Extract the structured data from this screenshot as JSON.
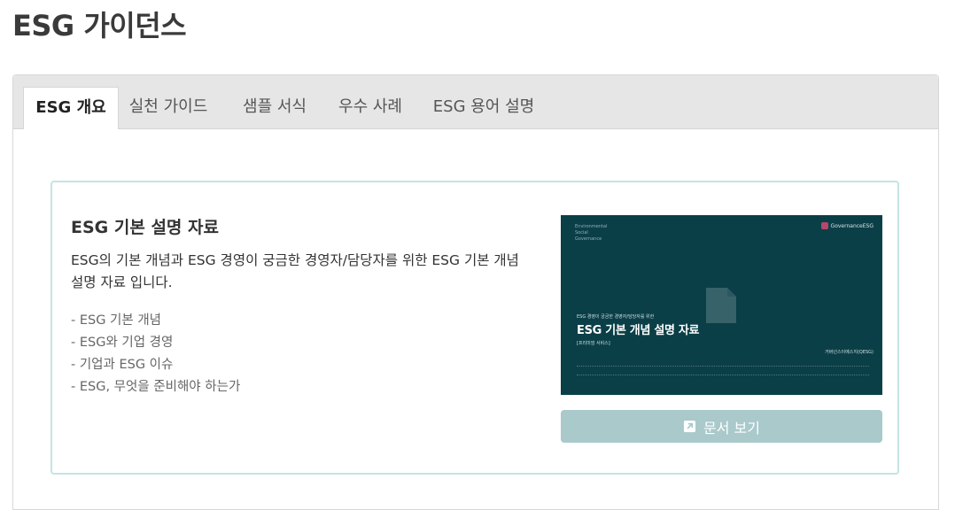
{
  "page": {
    "title": "ESG 가이던스"
  },
  "tabs": [
    {
      "label": "ESG 개요",
      "active": true
    },
    {
      "label": "실천 가이드",
      "active": false
    },
    {
      "label": "샘플 서식",
      "active": false
    },
    {
      "label": "우수 사례",
      "active": false
    },
    {
      "label": "ESG 용어 설명",
      "active": false
    }
  ],
  "card": {
    "title": "ESG 기본 설명 자료",
    "description": "ESG의 기본 개념과 ESG 경영이 궁금한 경영자/담당자를 위한 ESG 기본 개념 설명 자료 입니다.",
    "topics": [
      "- ESG 기본 개념",
      "- ESG와 기업 경영",
      "- 기업과 ESG 이슈",
      "- ESG, 무엇을 준비해야 하는가"
    ],
    "thumbnail": {
      "tagline": [
        "Environmental",
        "Social",
        "Governance"
      ],
      "brand": "GovernanceESG",
      "subtitle": "ESG 경영이 궁금한 경영자/담당자를 위한",
      "main_title": "ESG 기본 개념 설명 자료",
      "tag": "[프리미엄 서비스]",
      "org": "거버넌스이에스지(QESG)"
    },
    "button": {
      "label": "문서 보기",
      "icon": "external-link-icon"
    }
  },
  "colors": {
    "tab_bar": "#e6e6e6",
    "card_border": "#c4e4e4",
    "thumbnail_bg": "#0b3f48",
    "button_bg": "#a9c9cb"
  }
}
